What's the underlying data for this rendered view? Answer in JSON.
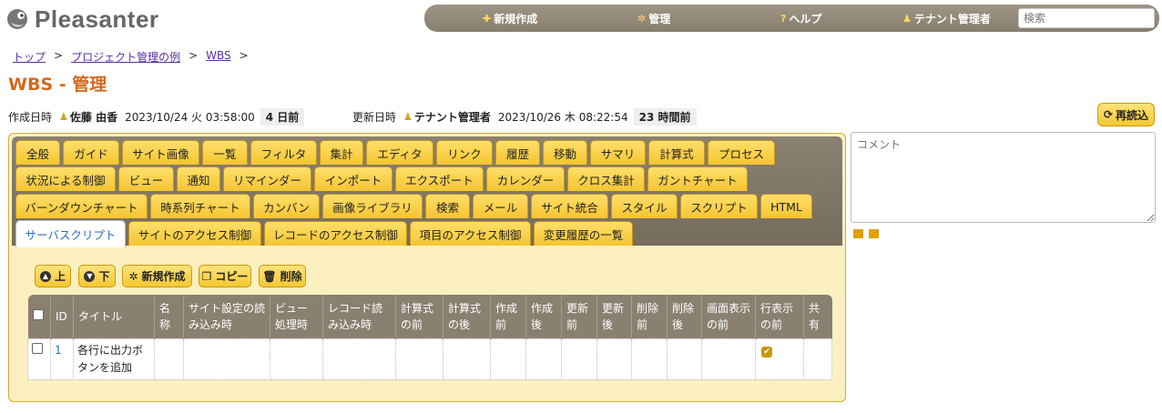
{
  "app": {
    "logo_text": "Pleasanter"
  },
  "nav": {
    "items": [
      {
        "label": "新規作成",
        "icon": "plus-icon"
      },
      {
        "label": "管理",
        "icon": "gear-icon"
      },
      {
        "label": "ヘルプ",
        "icon": "question-icon"
      },
      {
        "label": "テナント管理者",
        "icon": "user-icon"
      }
    ],
    "search_placeholder": "検索"
  },
  "breadcrumb": [
    "トップ",
    "プロジェクト管理の例",
    "WBS"
  ],
  "breadcrumb_sep": ">",
  "page": {
    "title": "WBS - 管理"
  },
  "meta": {
    "created_label": "作成日時",
    "created_user": "佐藤 由香",
    "created_at": "2023/10/24 火 03:58:00",
    "created_ago": "4 日前",
    "updated_label": "更新日時",
    "updated_user": "テナント管理者",
    "updated_at": "2023/10/26 木 08:22:54",
    "updated_ago": "23 時間前"
  },
  "reload_label": "再読込",
  "tabs": [
    [
      "全般",
      "ガイド",
      "サイト画像",
      "一覧",
      "フィルタ",
      "集計",
      "エディタ",
      "リンク",
      "履歴",
      "移動",
      "サマリ",
      "計算式",
      "プロセス"
    ],
    [
      "状況による制御",
      "ビュー",
      "通知",
      "リマインダー",
      "インポート",
      "エクスポート",
      "カレンダー",
      "クロス集計",
      "ガントチャート"
    ],
    [
      "バーンダウンチャート",
      "時系列チャート",
      "カンバン",
      "画像ライブラリ",
      "検索",
      "メール",
      "サイト統合",
      "スタイル",
      "スクリプト",
      "HTML"
    ],
    [
      "サーバスクリプト",
      "サイトのアクセス制御",
      "レコードのアクセス制御",
      "項目のアクセス制御",
      "変更履歴の一覧"
    ]
  ],
  "active_tab": "サーバスクリプト",
  "toolbar": {
    "up": "上",
    "down": "下",
    "new": "新規作成",
    "copy": "コピー",
    "delete": "削除"
  },
  "grid": {
    "headers": [
      "",
      "ID",
      "タイトル",
      "名称",
      "サイト設定の読み込み時",
      "ビュー処理時",
      "レコード読み込み時",
      "計算式の前",
      "計算式の後",
      "作成前",
      "作成後",
      "更新前",
      "更新後",
      "削除前",
      "削除後",
      "画面表示の前",
      "行表示の前",
      "共有"
    ],
    "rows": [
      {
        "id": "1",
        "title": "各行に出力ボタンを追加",
        "row_display_before": true
      }
    ]
  },
  "comment_placeholder": "コメント"
}
